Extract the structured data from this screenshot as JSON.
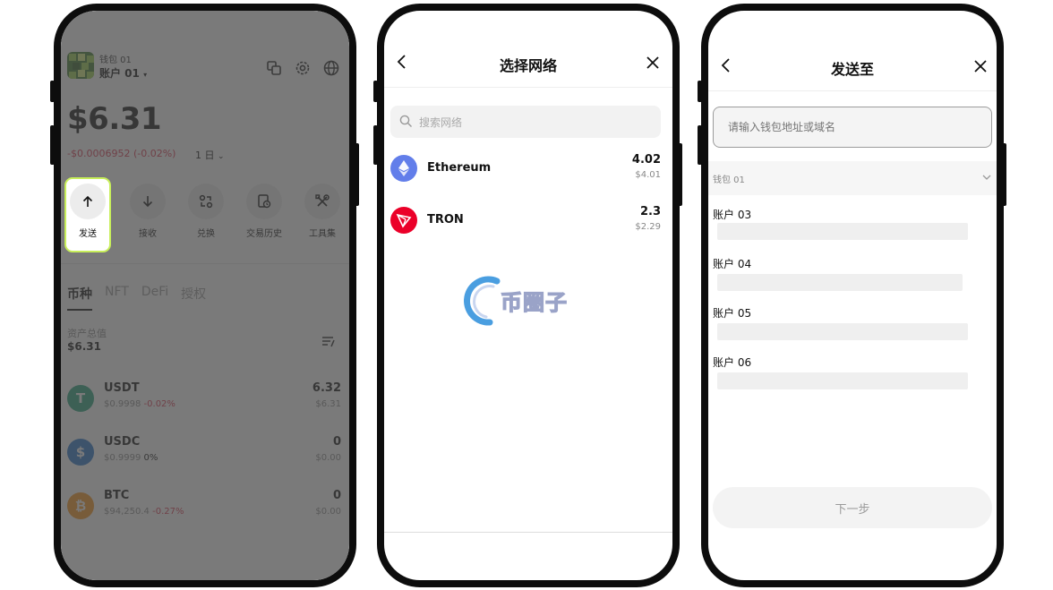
{
  "screen1": {
    "wallet_label": "钱包 01",
    "account_label": "账户 01",
    "balance": "$6.31",
    "change": "-$0.0006952 (-0.02%)",
    "period": "1 日",
    "actions": [
      {
        "label": "发送",
        "icon": "arrow-up-icon"
      },
      {
        "label": "接收",
        "icon": "arrow-down-icon"
      },
      {
        "label": "兑换",
        "icon": "swap-icon"
      },
      {
        "label": "交易历史",
        "icon": "history-icon"
      },
      {
        "label": "工具集",
        "icon": "tools-icon"
      }
    ],
    "tabs": [
      "币种",
      "NFT",
      "DeFi",
      "授权"
    ],
    "assets_title": "资产总值",
    "assets_total": "$6.31",
    "tokens": [
      {
        "symbol": "USDT",
        "price": "$0.9998",
        "change": "-0.02%",
        "amount": "6.32",
        "value": "$6.31",
        "color": "#26a17b",
        "glyph": "T"
      },
      {
        "symbol": "USDC",
        "price": "$0.9999",
        "change": "0%",
        "amount": "0",
        "value": "$0.00",
        "color": "#2775ca",
        "glyph": "$"
      },
      {
        "symbol": "BTC",
        "price": "$94,250.4",
        "change": "-0.27%",
        "amount": "0",
        "value": "$0.00",
        "color": "#f7931a",
        "glyph": "₿"
      }
    ],
    "highlight_color": "#c8ef5a",
    "negative_color": "#d9324b"
  },
  "screen2": {
    "title": "选择网络",
    "search_placeholder": "搜索网络",
    "networks": [
      {
        "name": "Ethereum",
        "amount": "4.02",
        "value": "$4.01",
        "color": "#627eea"
      },
      {
        "name": "TRON",
        "amount": "2.3",
        "value": "$2.29",
        "color": "#eb0029"
      }
    ],
    "watermark": "币圈子"
  },
  "screen3": {
    "title": "发送至",
    "address_placeholder": "请输入钱包地址或域名",
    "wallet_group": "钱包 01",
    "accounts": [
      "账户 03",
      "账户 04",
      "账户 05",
      "账户 06"
    ],
    "next_label": "下一步"
  }
}
